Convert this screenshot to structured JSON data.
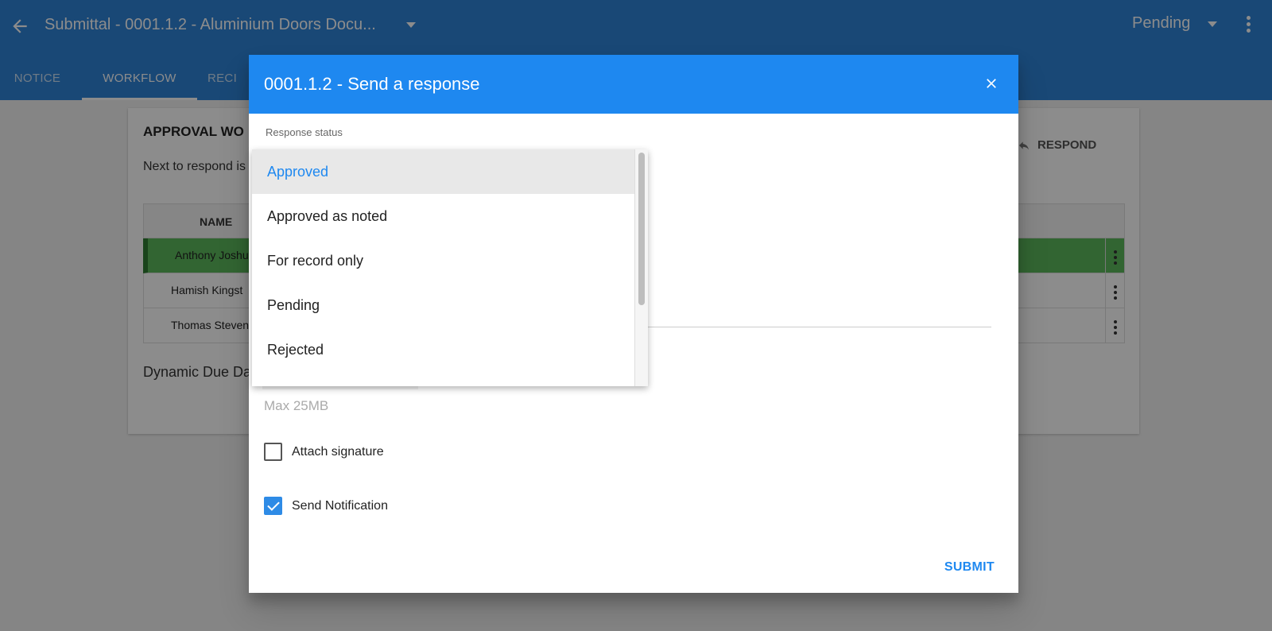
{
  "appbar": {
    "title": "Submittal - 0001.1.2 - Aluminium Doors Docu...",
    "status": "Pending"
  },
  "tabs": [
    {
      "label": "NOTICE"
    },
    {
      "label": "WORKFLOW"
    },
    {
      "label": "RECI"
    }
  ],
  "card": {
    "title": "APPROVAL WO",
    "next_text": "Next to respond is",
    "respond_label": "RESPOND",
    "table_header_name": "NAME",
    "rows": [
      {
        "name": "Anthony Joshu"
      },
      {
        "name": "Hamish Kingst"
      },
      {
        "name": "Thomas Steven"
      }
    ],
    "dynamic_due": "Dynamic Due Da"
  },
  "dialog": {
    "title": "0001.1.2 - Send a response",
    "response_status_label": "Response status",
    "max_size": "Max 25MB",
    "attach_signature_label": "Attach signature",
    "attach_signature_checked": false,
    "send_notification_label": "Send Notification",
    "send_notification_checked": true,
    "submit_label": "SUBMIT"
  },
  "dropdown": {
    "options": [
      {
        "label": "Approved",
        "selected": true
      },
      {
        "label": "Approved as noted",
        "selected": false
      },
      {
        "label": "For record only",
        "selected": false
      },
      {
        "label": "Pending",
        "selected": false
      },
      {
        "label": "Rejected",
        "selected": false
      }
    ]
  },
  "colors": {
    "appbar": "#2e83d8",
    "dialog_header": "#1e88f0",
    "current_row": "#5cb85c",
    "accent": "#1e88f0"
  }
}
